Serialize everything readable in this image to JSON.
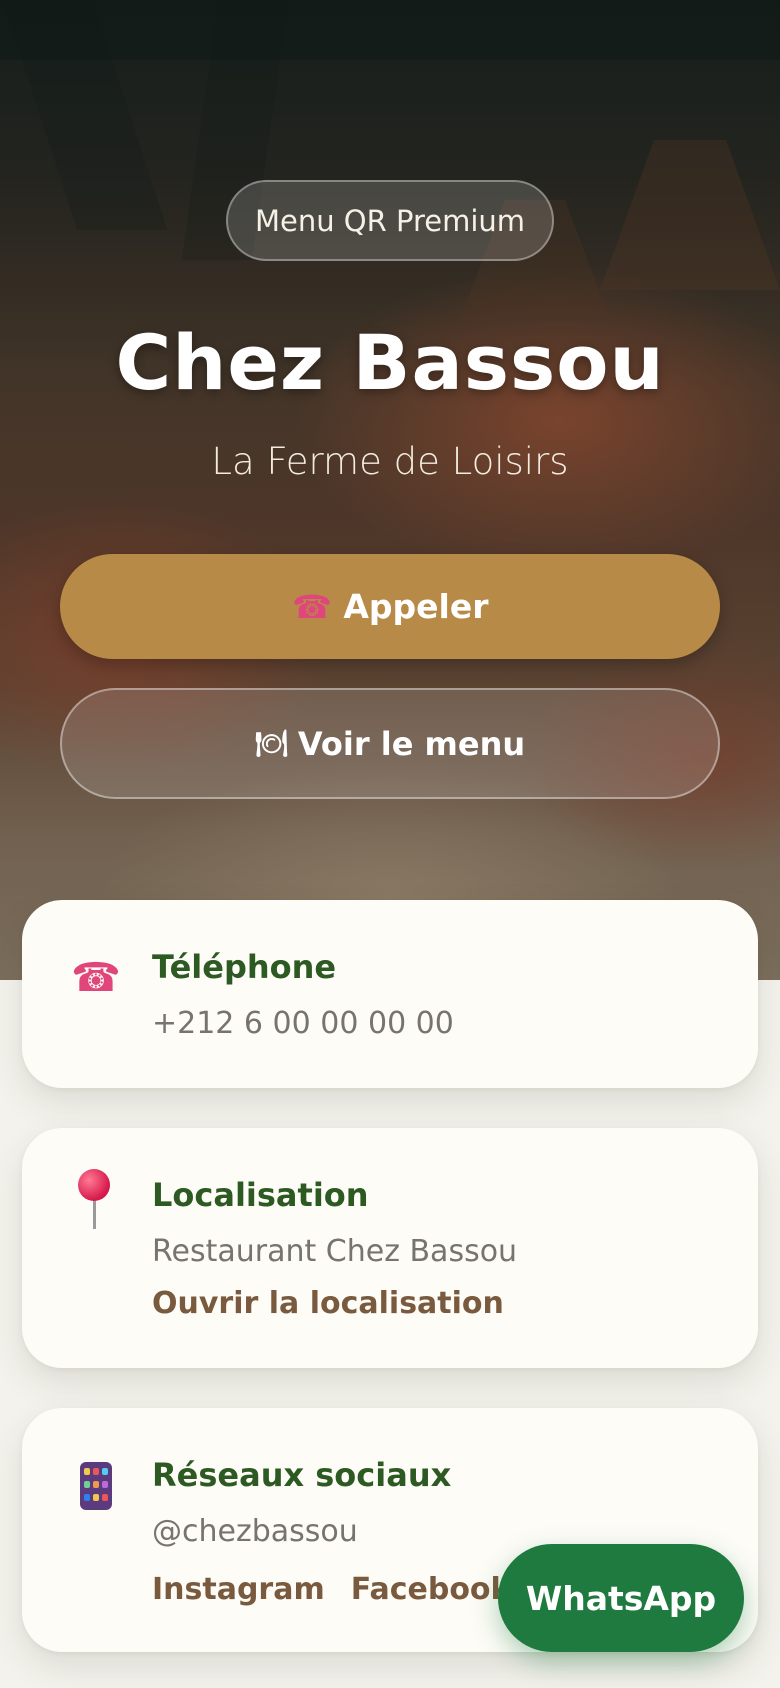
{
  "hero": {
    "badge": "Menu QR Premium",
    "title": "Chez Bassou",
    "subtitle": "La Ferme de Loisirs",
    "call_button": "Appeler",
    "menu_button": "Voir le menu"
  },
  "cards": {
    "phone": {
      "heading": "Téléphone",
      "value": "+212 6 00 00 00 00"
    },
    "location": {
      "heading": "Localisation",
      "value": "Restaurant Chez Bassou",
      "link": "Ouvrir la localisation"
    },
    "social": {
      "heading": "Réseaux sociaux",
      "value": "@chezbassou",
      "links": [
        "Instagram",
        "Facebook"
      ]
    }
  },
  "whatsapp_button": "WhatsApp",
  "colors": {
    "accent_gold": "#b88a48",
    "heading_green": "#2d5a22",
    "link_brown": "#7a5a3e",
    "whatsapp_green": "#1e7a3e",
    "background": "#f3f2ec"
  },
  "icons": {
    "call": "telephone-receiver-icon",
    "menu": "fork-knife-plate-icon",
    "phone": "telephone-receiver-icon",
    "location": "round-pushpin-icon",
    "social": "mobile-phone-icon"
  }
}
